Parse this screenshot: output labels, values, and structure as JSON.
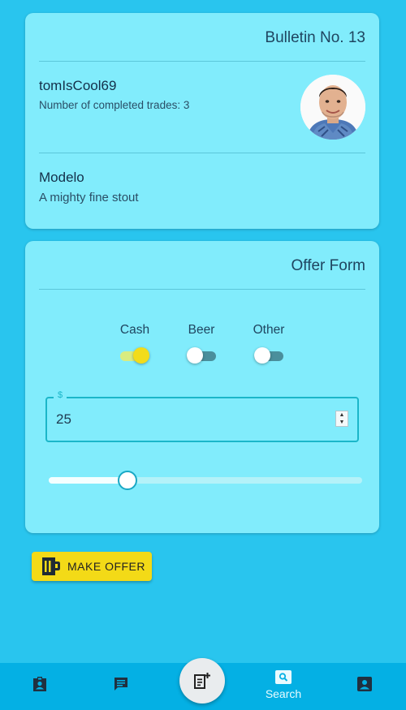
{
  "bulletin": {
    "title": "Bulletin No. 13",
    "username": "tomIsCool69",
    "trades": "Number of completed trades: 3",
    "item_name": "Modelo",
    "item_description": "A mighty fine stout"
  },
  "offer_form": {
    "title": "Offer Form",
    "toggles": [
      {
        "label": "Cash",
        "on": true
      },
      {
        "label": "Beer",
        "on": false
      },
      {
        "label": "Other",
        "on": false
      }
    ],
    "amount_legend": "$",
    "amount_value": "25",
    "slider_fraction": 0.25
  },
  "make_offer": {
    "label": "MAKE OFFER",
    "icon": "beer-mug-icon"
  },
  "nav": {
    "items": [
      {
        "icon": "badge-icon"
      },
      {
        "icon": "message-icon"
      },
      {
        "icon": "note-add-icon"
      },
      {
        "icon": "search-icon",
        "label": "Search"
      },
      {
        "icon": "account-box-icon"
      }
    ]
  },
  "colors": {
    "background": "#29c5ee",
    "card": "#81ecfc",
    "accent_yellow": "#f3da17",
    "nav": "#04b0e4"
  }
}
